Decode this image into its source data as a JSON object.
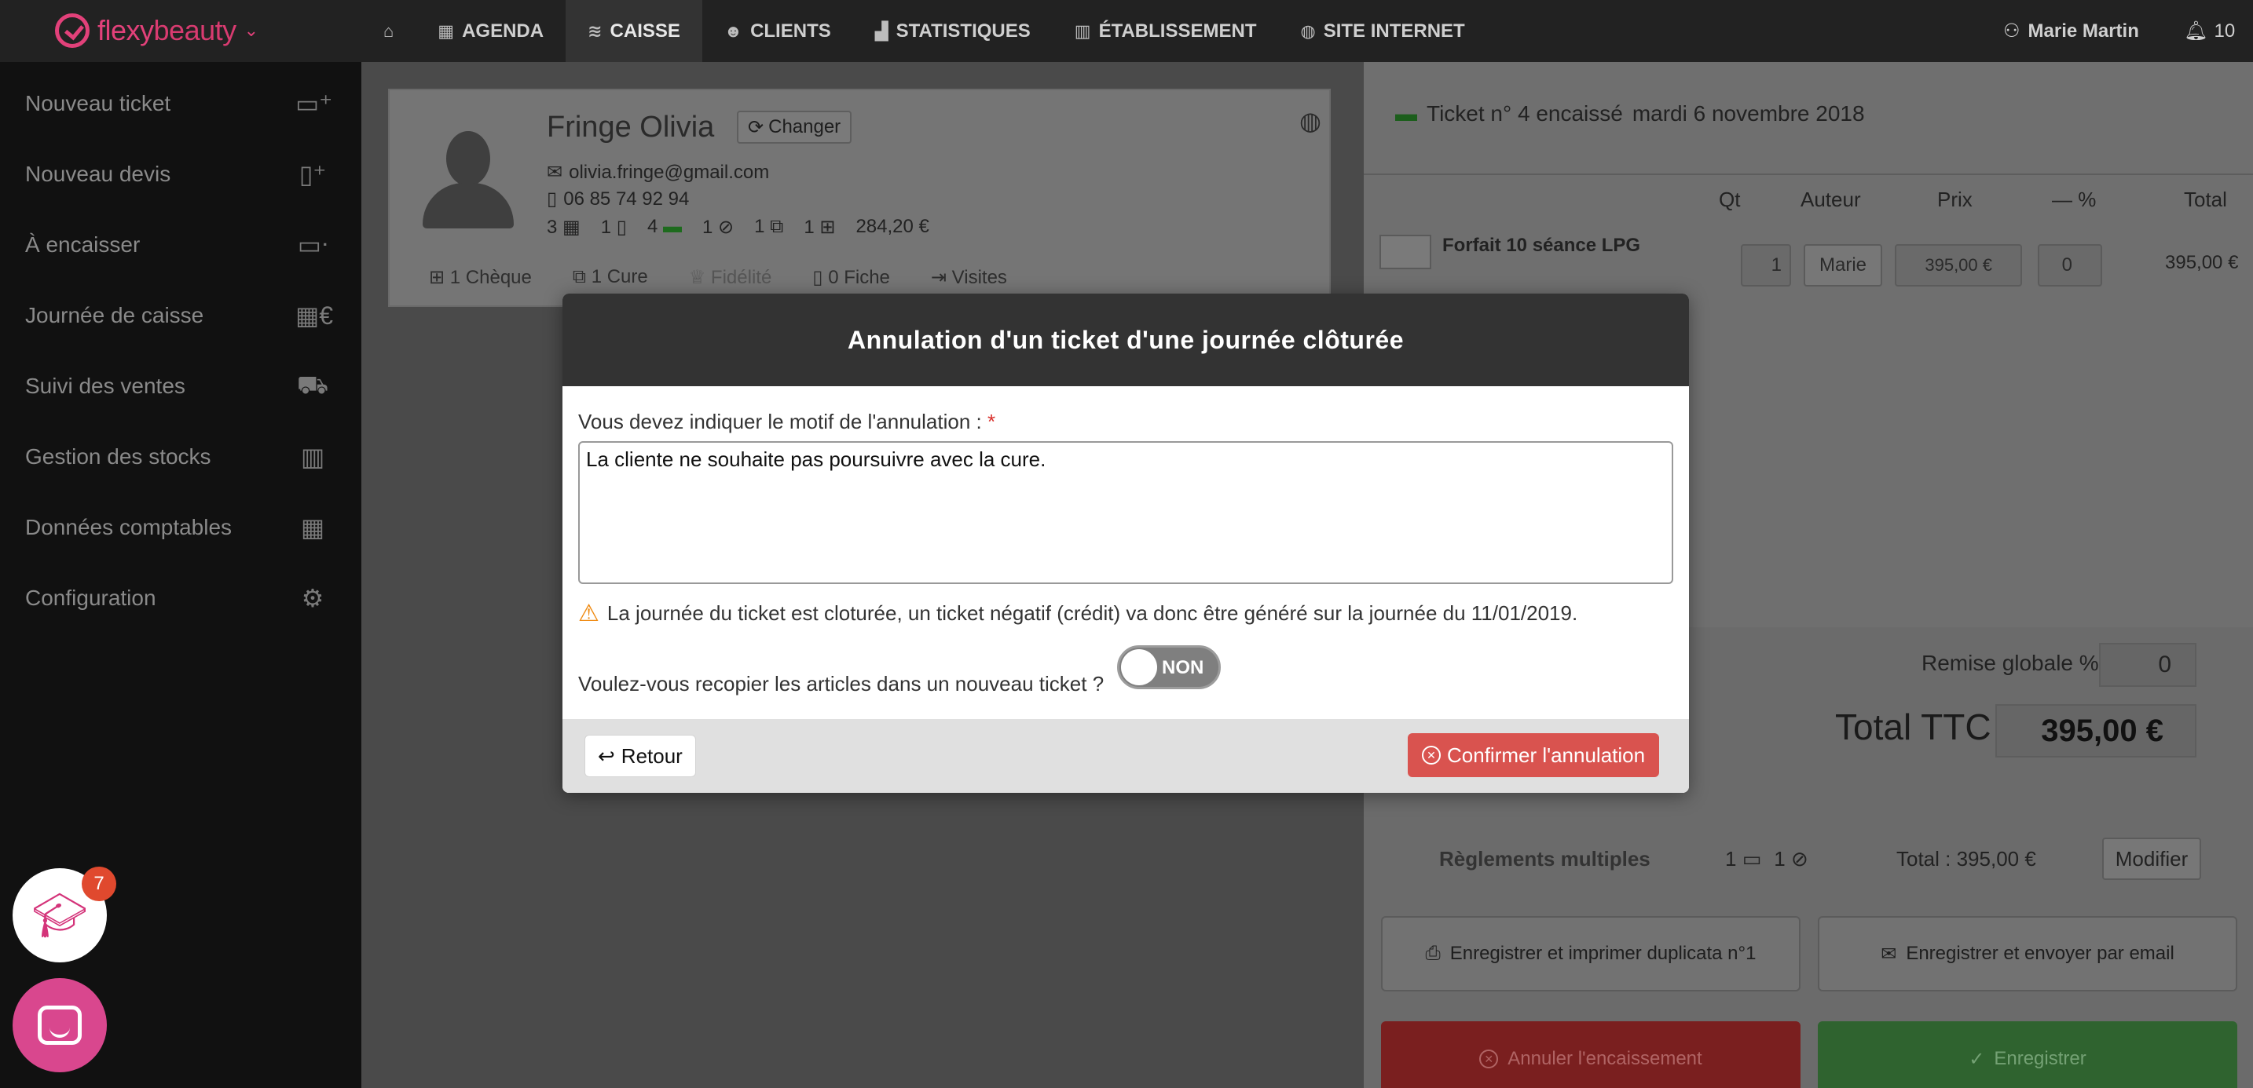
{
  "app": {
    "brand_prefix": "flexy",
    "brand_suffix": "beauty"
  },
  "nav": {
    "home_icon": "home-icon",
    "items": [
      {
        "label": "AGENDA",
        "icon": "calendar-icon"
      },
      {
        "label": "CAISSE",
        "icon": "cash-icon"
      },
      {
        "label": "CLIENTS",
        "icon": "users-icon"
      },
      {
        "label": "STATISTIQUES",
        "icon": "chart-icon"
      },
      {
        "label": "ÉTABLISSEMENT",
        "icon": "store-icon"
      },
      {
        "label": "SITE INTERNET",
        "icon": "globe-icon"
      }
    ],
    "user_name": "Marie Martin",
    "notifications": "10"
  },
  "sidebar": {
    "items": [
      {
        "label": "Nouveau ticket"
      },
      {
        "label": "Nouveau devis"
      },
      {
        "label": "À encaisser"
      },
      {
        "label": "Journée de caisse"
      },
      {
        "label": "Suivi des ventes"
      },
      {
        "label": "Gestion des stocks"
      },
      {
        "label": "Données comptables"
      },
      {
        "label": "Configuration"
      }
    ]
  },
  "client": {
    "name": "Fringe Olivia",
    "change_label": "Changer",
    "email": "olivia.fringe@gmail.com",
    "phone": "06 85 74 92 94",
    "stats": {
      "appointments": "3",
      "documents": "1",
      "tickets": "4",
      "credits": "1",
      "cures": "1",
      "gifts": "1",
      "amount": "284,20 €"
    },
    "tabs": [
      {
        "label": "1 Chèque"
      },
      {
        "label": "1 Cure"
      },
      {
        "label": "Fidélité"
      },
      {
        "label": "0 Fiche"
      },
      {
        "label": "Visites"
      }
    ]
  },
  "ticket": {
    "header": "Ticket n° 4 encaissé",
    "date": "mardi 6 novembre 2018",
    "columns": {
      "qt": "Qt",
      "auteur": "Auteur",
      "prix": "Prix",
      "remise": "— %",
      "total": "Total"
    },
    "line": {
      "title": "Forfait 10 séance LPG",
      "qty": "1",
      "author": "Marie",
      "price": "395,00 €",
      "discount": "0",
      "total": "395,00 €"
    },
    "remise_label": "Remise globale %",
    "remise_value": "0",
    "ttc_label": "Total TTC",
    "ttc_value": "395,00 €",
    "reglements_label": "Règlements multiples",
    "reglements_card": "1",
    "reglements_credit": "1",
    "reglements_total": "Total : 395,00 €",
    "modify_label": "Modifier",
    "print_label": "Enregistrer et imprimer duplicata n°1",
    "email_label": "Enregistrer et envoyer par email",
    "cancel_label": "Annuler l'encaissement",
    "save_label": "Enregistrer"
  },
  "widgets": {
    "academy_badge": "7"
  },
  "modal": {
    "title": "Annulation d'un ticket d'une journée clôturée",
    "reason_label": "Vous devez indiquer le motif de l'annulation :",
    "required_mark": "*",
    "reason_value": "La cliente ne souhaite pas poursuivre avec la cure.",
    "warning": "La journée du ticket est cloturée, un ticket négatif (crédit) va donc être généré sur la journée du 11/01/2019.",
    "copy_question": "Voulez-vous recopier les articles dans un nouveau ticket ?",
    "toggle_label": "NON",
    "back_label": "Retour",
    "confirm_label": "Confirmer l'annulation"
  }
}
